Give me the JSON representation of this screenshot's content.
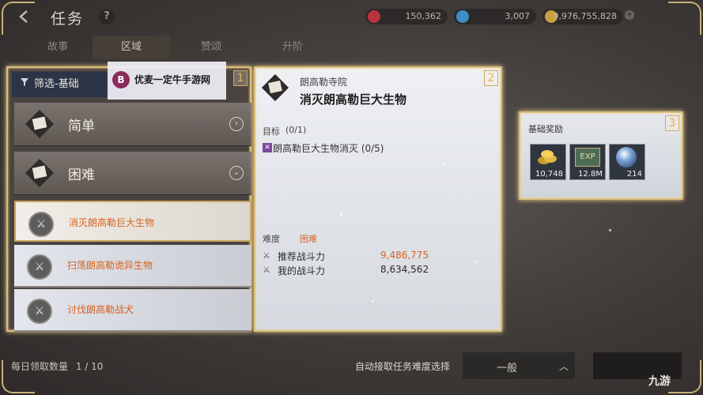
{
  "header": {
    "title": "任务",
    "help_label": "?",
    "currencies": [
      {
        "icon": "red-gem-icon",
        "value": "150,362",
        "color": "#b8343c"
      },
      {
        "icon": "blue-crystal-icon",
        "value": "3,007",
        "color": "#3b8fc4"
      },
      {
        "icon": "gold-coin-icon",
        "value": "9,976,755,828",
        "color": "#c7a040"
      }
    ],
    "plus_label": "+"
  },
  "tabs": [
    {
      "label": "故事",
      "active": false
    },
    {
      "label": "区域",
      "active": true
    },
    {
      "label": "赞颂",
      "active": false
    },
    {
      "label": "升阶",
      "active": false
    }
  ],
  "left_panel": {
    "number": "1",
    "filter_label": "筛选-基础",
    "categories": [
      {
        "label": "简单",
        "arrow": "right"
      },
      {
        "label": "困难",
        "arrow": "down"
      }
    ],
    "quests": [
      {
        "label": "消灭朗高勒巨大生物",
        "selected": true
      },
      {
        "label": "扫荡朗高勒诡异生物",
        "selected": false
      },
      {
        "label": "讨伐朗高勒战犬",
        "selected": false
      }
    ],
    "daily_label": "每日领取数量",
    "daily_count": "1 / 10"
  },
  "watermark": {
    "logo": "B",
    "text": "优麦一定牛手游网"
  },
  "detail_panel": {
    "number": "2",
    "location": "朗高勒寺院",
    "quest_title": "消灭朗高勒巨大生物",
    "objective_label": "目标",
    "objective_count": "(0/1)",
    "objective_text": "朗高勒巨大生物消灭 (0/5)",
    "difficulty_label": "难度",
    "difficulty_value": "困难",
    "recommended_label": "推荐战斗力",
    "recommended_value": "9,486,775",
    "my_power_label": "我的战斗力",
    "my_power_value": "8,634,562",
    "recommended_color": "#d9611f"
  },
  "reward_panel": {
    "number": "3",
    "title": "基础奖励",
    "rewards": [
      {
        "icon": "gold-coins-icon",
        "value": "10,748"
      },
      {
        "icon": "exp-icon",
        "label": "EXP",
        "value": "12.8M"
      },
      {
        "icon": "orb-icon",
        "value": "214"
      }
    ]
  },
  "footer": {
    "auto_accept_label": "自动接取任务难度选择",
    "dropdown_value": "一般",
    "site_logo": "九游"
  }
}
